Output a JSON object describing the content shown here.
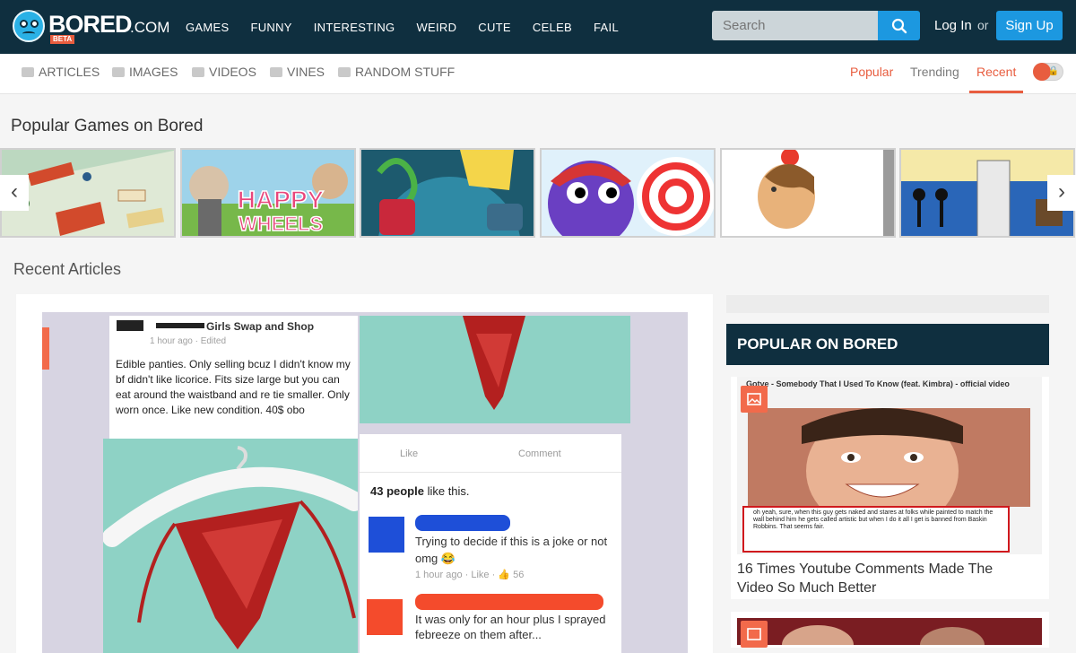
{
  "logo": {
    "brand": "BORED",
    "suffix": ".COM",
    "badge": "BETA"
  },
  "mainnav": {
    "items": [
      "GAMES",
      "FUNNY",
      "INTERESTING",
      "WEIRD",
      "CUTE",
      "CELEB",
      "FAIL"
    ]
  },
  "header": {
    "search_placeholder": "Search",
    "login": "Log In",
    "or": "or",
    "signup": "Sign Up"
  },
  "subnav": {
    "categories": [
      "ARTICLES",
      "IMAGES",
      "VIDEOS",
      "VINES",
      "RANDOM STUFF"
    ],
    "sort": [
      "Popular",
      "Trending",
      "Recent"
    ],
    "active_sort": "Recent"
  },
  "games_section": {
    "title": "Popular Games on Bored"
  },
  "recent_section": {
    "title": "Recent Articles"
  },
  "article": {
    "post_name": "Girls Swap and Shop",
    "post_time": "1 hour ago · Edited",
    "post_body": "Edible panties. Only selling bcuz I didn't know my bf didn't like licorice. Fits size large but you can eat around the waistband and re tie smaller. Only worn once. Like new condition. 40$ obo",
    "like_label": "Like",
    "comment_label": "Comment",
    "likes_count": "43 people",
    "likes_suffix": " like this.",
    "comment1": "Trying to decide if this is a joke or not omg 😂",
    "comment1_meta": "1 hour ago · Like · 👍 56",
    "comment2": "It was only for an hour plus I sprayed febreeze on them after..."
  },
  "sidebar": {
    "header": "POPULAR ON BORED",
    "card1": {
      "image_caption": "Gotye - Somebody That I Used To Know (feat. Kimbra) - official video",
      "comment": "oh yeah, sure, when this guy gets naked and stares at folks while painted to match the wall behind him he gets called artistic but when I do it all I get is banned from Baskin Robbins. That seems fair.",
      "title": "16 Times Youtube Comments Made The Video So Much Better"
    }
  }
}
